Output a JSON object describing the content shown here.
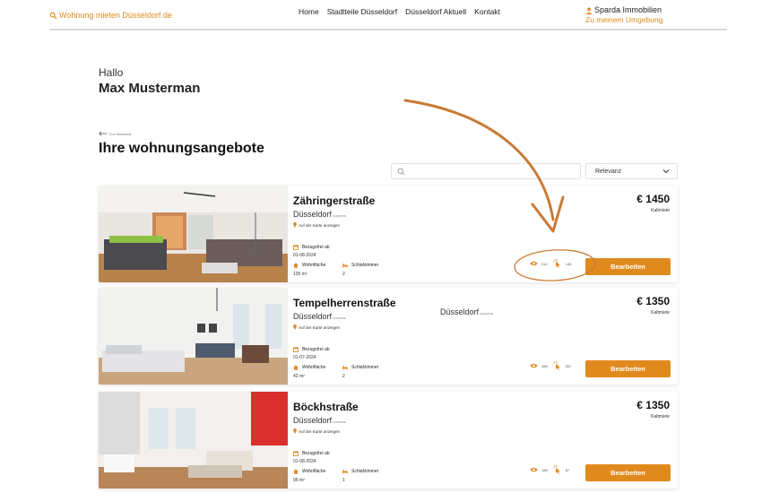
{
  "header": {
    "logo_text": "Wohnung mieten Düsseldorf.de",
    "nav": [
      "Home",
      "Stadtteile Düsseldorf",
      "Düsseldorf Aktuell",
      "Kontakt"
    ],
    "account_name": "Sparda Immobilien",
    "account_sub": "Zu meinem Umgebung"
  },
  "greeting": {
    "hello": "Hallo",
    "name": "Max Musterman"
  },
  "back_link": "Zur Übersicht",
  "page_title": "Ihre wohnungsangebote",
  "search": {
    "placeholder": ""
  },
  "sort": {
    "selected": "Relevanz"
  },
  "labels": {
    "map_link": "Auf der Karte anzeigen",
    "available_from": "Bezugsfrei ab",
    "living_area": "Wohnfläche",
    "bedrooms": "Schlafzimmer",
    "price_note": "Kaltmiete",
    "edit_button": "Bearbeiten"
  },
  "listings": [
    {
      "street": "Zähringerstraße",
      "city": "Düsseldorf",
      "code": "012345789",
      "date": "01-08-2024",
      "area": "105 m²",
      "rooms": "2",
      "price": "€ 1450",
      "views": "312",
      "clicks": "145"
    },
    {
      "street": "Tempelherrenstraße",
      "city": "Düsseldorf",
      "code": "012345789",
      "middle_city": "Düsseldorf",
      "middle_code": "012345789",
      "date": "01-07-2024",
      "area": "42 m²",
      "rooms": "2",
      "price": "€ 1350",
      "views": "485",
      "clicks": "267"
    },
    {
      "street": "Böckhstraße",
      "city": "Düsseldorf",
      "code": "012345789",
      "date": "01-08-2024",
      "area": "95 m²",
      "rooms": "1",
      "price": "€ 1350",
      "views": "185",
      "clicks": "87"
    }
  ],
  "colors": {
    "accent": "#e08a1e",
    "annotation": "#c97a35"
  }
}
